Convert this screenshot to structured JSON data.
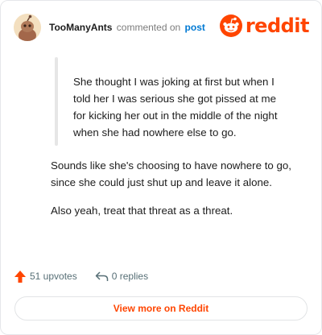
{
  "comment": {
    "author": "TooManyAnts",
    "action_text": "commented on",
    "post_link": "post",
    "quote": "She thought I was joking at first but when I told her I was serious she got pissed at me for kicking her out in the middle of the night when she had nowhere else to go.",
    "paragraphs": [
      "Sounds like she's choosing to have nowhere to go, since she could just shut up and leave it alone.",
      "Also yeah, treat that threat as a threat."
    ]
  },
  "brand": {
    "logo_text": "reddit",
    "color": "#ff4500"
  },
  "actions": {
    "upvotes": "51 upvotes",
    "replies": "0 replies"
  },
  "footer": {
    "view_more": "View more on Reddit"
  },
  "icons": {
    "avatar": "snoo-avatar-icon",
    "logo": "reddit-snoo-icon",
    "upvote": "upvote-arrow-icon",
    "reply": "reply-arrow-icon"
  }
}
